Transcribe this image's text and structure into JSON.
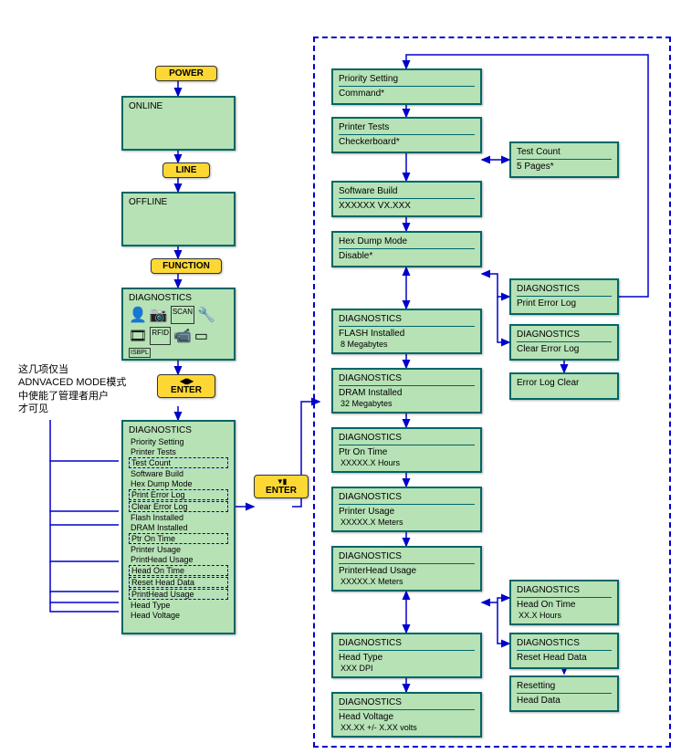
{
  "buttons": {
    "power": "POWER",
    "line": "LINE",
    "function": "FUNCTION",
    "enter1": "ENTER",
    "enter2": "ENTER"
  },
  "left": {
    "online": "ONLINE",
    "offline": "OFFLINE",
    "diag_title": "DIAGNOSTICS",
    "diag_list_title": "DIAGNOSTICS",
    "items": {
      "priority": "Priority Setting",
      "printer_tests": "Printer Tests",
      "test_count": "Test Count",
      "software_build": "Software Build",
      "hex_dump": "Hex Dump Mode",
      "print_err": "Print Error Log",
      "clear_err": "Clear Error Log",
      "flash": "Flash Installed",
      "dram": "DRAM Installed",
      "ptr_on": "Ptr On Time",
      "printer_usage": "Printer Usage",
      "ph_usage": "PrintHead Usage",
      "head_on": "Head On Time",
      "reset_head": "Reset Head Data",
      "ph_usage2": "PrintHead Usage",
      "head_type": "Head Type",
      "head_voltage": "Head Voltage"
    }
  },
  "note": {
    "l1": "这几项仅当",
    "l2": "ADNVACED MODE模式",
    "l3": "中使能了管理者用户",
    "l4": "才可见"
  },
  "right": {
    "priority": {
      "t": "Priority Setting",
      "s": "Command*"
    },
    "printer_tests": {
      "t": "Printer Tests",
      "s": "Checkerboard*"
    },
    "test_count": {
      "t": "Test Count",
      "s": "5  Pages*"
    },
    "software_build": {
      "t": "Software Build",
      "s": "XXXXXX  VX.XXX"
    },
    "hex_dump": {
      "t": "Hex Dump Mode",
      "s": "Disable*"
    },
    "diag_print_err": {
      "t": "DIAGNOSTICS",
      "s": "Print Error Log"
    },
    "diag_clear_err": {
      "t": "DIAGNOSTICS",
      "s": "Clear Error Log"
    },
    "err_clear": {
      "t": "Error Log Clear",
      "s": ""
    },
    "flash": {
      "t": "DIAGNOSTICS",
      "s1": "FLASH Installed",
      "s2": "8 Megabytes"
    },
    "dram": {
      "t": "DIAGNOSTICS",
      "s1": "DRAM Installed",
      "s2": "32 Megabytes"
    },
    "ptr_on": {
      "t": "DIAGNOSTICS",
      "s1": "Ptr On Time",
      "s2": "XXXXX.X  Hours"
    },
    "printer_usage": {
      "t": "DIAGNOSTICS",
      "s1": "Printer Usage",
      "s2": "XXXXX.X  Meters"
    },
    "ph_usage": {
      "t": "DIAGNOSTICS",
      "s1": "PrinterHead Usage",
      "s2": "XXXXX.X  Meters"
    },
    "head_on": {
      "t": "DIAGNOSTICS",
      "s1": "Head On Time",
      "s2": "XX.X Hours"
    },
    "reset_head": {
      "t": "DIAGNOSTICS",
      "s": "Reset Head Data"
    },
    "resetting": {
      "t": "Resetting",
      "s": "Head Data"
    },
    "head_type": {
      "t": "DIAGNOSTICS",
      "s1": "Head Type",
      "s2": "XXX  DPI"
    },
    "head_voltage": {
      "t": "DIAGNOSTICS",
      "s1": "Head Voltage",
      "s2": "XX.XX +/- X.XX  volts"
    }
  }
}
